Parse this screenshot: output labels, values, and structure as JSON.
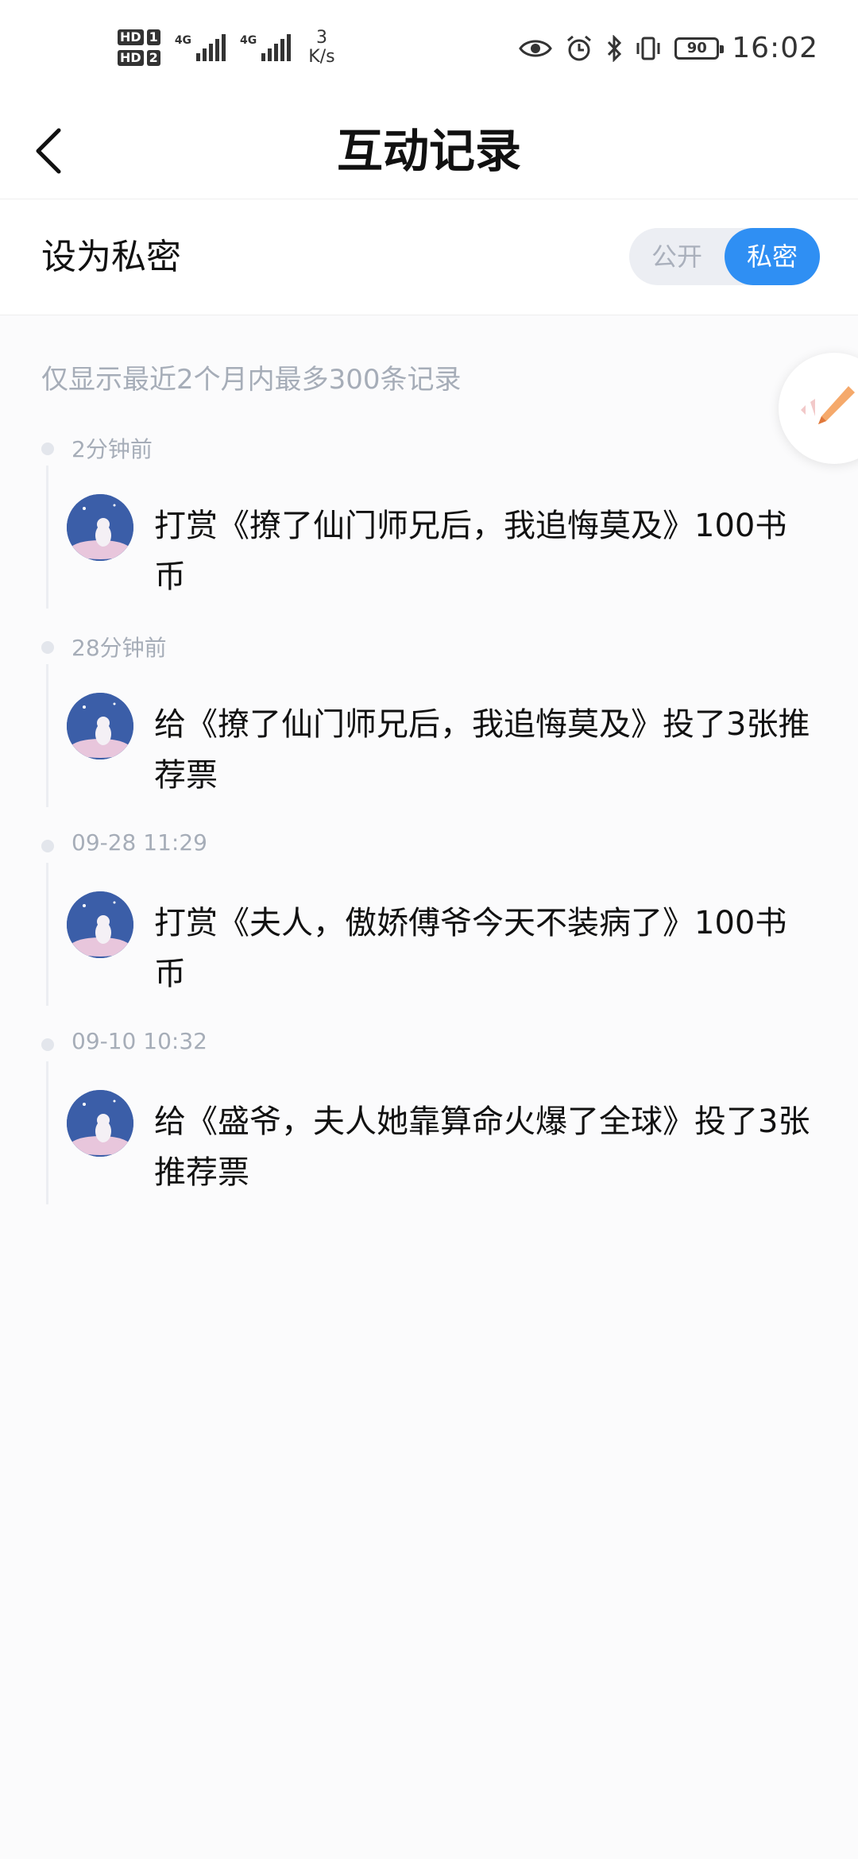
{
  "status_bar": {
    "hd1": "HD",
    "hd1_num": "1",
    "hd2": "HD",
    "hd2_num": "2",
    "net1": "4G",
    "net2": "4G",
    "speed_value": "3",
    "speed_unit": "K/s",
    "battery": "90",
    "time": "16:02"
  },
  "header": {
    "title": "互动记录"
  },
  "privacy": {
    "label": "设为私密",
    "option_public": "公开",
    "option_private": "私密",
    "selected": "私密",
    "accent_color": "#2f8ff3"
  },
  "note": "仅显示最近2个月内最多300条记录",
  "records": [
    {
      "time": "2分钟前",
      "text": "打赏《撩了仙门师兄后，我追悔莫及》100书币"
    },
    {
      "time": "28分钟前",
      "text": "给《撩了仙门师兄后，我追悔莫及》投了3张推荐票"
    },
    {
      "time": "09-28 11:29",
      "text": "打赏《夫人，傲娇傅爷今天不装病了》100书币"
    },
    {
      "time": "09-10 10:32",
      "text": "给《盛爷，夫人她靠算命火爆了全球》投了3张推荐票"
    }
  ],
  "icons": {
    "back": "chevron-left-icon",
    "fab": "pen-icon"
  }
}
